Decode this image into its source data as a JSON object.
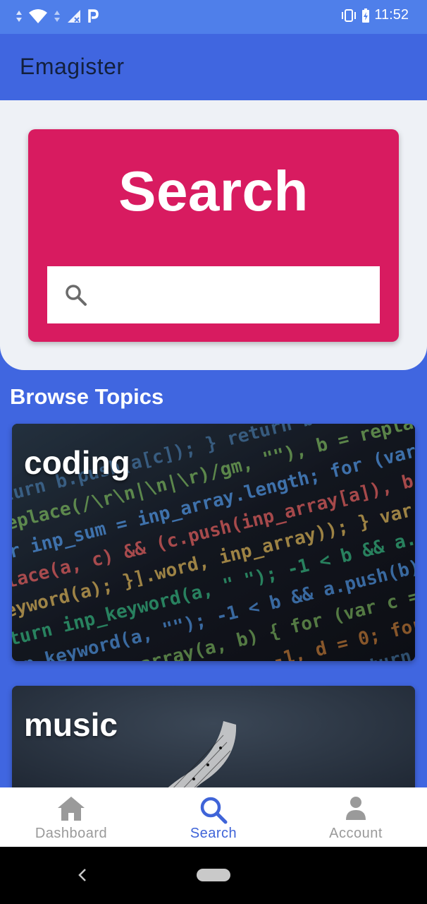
{
  "status_bar": {
    "time": "11:52",
    "icons_left": [
      "data-arrows-icon",
      "wifi-icon",
      "data-arrows-icon",
      "signal-no-service-icon",
      "parking-icon"
    ],
    "icons_right": [
      "vibrate-icon",
      "battery-charging-icon"
    ]
  },
  "app_bar": {
    "title": "Emagister"
  },
  "search_card": {
    "heading": "Search",
    "input_value": "",
    "input_placeholder": "",
    "icon": "search-icon",
    "accent_color": "#D81B60"
  },
  "browse": {
    "title": "Browse Topics",
    "topics": [
      {
        "label": "coding"
      },
      {
        "label": "music"
      }
    ]
  },
  "bottom_nav": {
    "items": [
      {
        "label": "Dashboard",
        "icon": "home-icon",
        "active": false
      },
      {
        "label": "Search",
        "icon": "search-icon",
        "active": true
      },
      {
        "label": "Account",
        "icon": "person-icon",
        "active": false
      }
    ],
    "active_color": "#3F64D8"
  },
  "colors": {
    "primary": "#4066E0",
    "status_bar": "#4F7FEA",
    "search_bg": "#EEF1F6"
  }
}
